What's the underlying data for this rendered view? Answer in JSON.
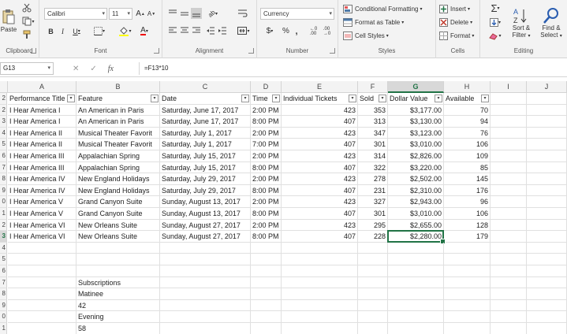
{
  "ribbon": {
    "clipboard": {
      "label": "Clipboard",
      "paste": "Paste"
    },
    "font": {
      "label": "Font",
      "name": "Calibri",
      "size": "11",
      "bold": "B",
      "italic": "I",
      "underline": "U",
      "grow": "A",
      "shrink": "A"
    },
    "alignment": {
      "label": "Alignment"
    },
    "number": {
      "label": "Number",
      "format": "Currency",
      "currency_symbol": "$",
      "percent": "%",
      "comma": ","
    },
    "styles": {
      "label": "Styles",
      "conditional": "Conditional Formatting",
      "format_table": "Format as Table",
      "cell_styles": "Cell Styles"
    },
    "cells": {
      "label": "Cells",
      "insert": "Insert",
      "delete": "Delete",
      "format": "Format"
    },
    "editing": {
      "label": "Editing",
      "sort1": "Sort &",
      "sort2": "Filter",
      "find1": "Find &",
      "find2": "Select"
    }
  },
  "formula_bar": {
    "name_box": "G13",
    "fx": "fx",
    "formula": "=F13*10"
  },
  "columns": [
    "A",
    "B",
    "C",
    "D",
    "E",
    "F",
    "G",
    "H",
    "I",
    "J"
  ],
  "selected_column": "G",
  "selected_row": "3",
  "header_row": {
    "row": "2",
    "cells": [
      "Performance Title",
      "Feature",
      "Date",
      "Time",
      "Individual Tickets",
      "Sold",
      "Dollar Value",
      "Available"
    ]
  },
  "rows": [
    {
      "num": "2",
      "cells": [
        "I Hear America I",
        "An American in Paris",
        "Saturday, June 17, 2017",
        "2:00 PM",
        "423",
        "353",
        "$3,177.00",
        "70"
      ]
    },
    {
      "num": "3",
      "cells": [
        "I Hear America I",
        "An American in Paris",
        "Saturday, June 17, 2017",
        "8:00 PM",
        "407",
        "313",
        "$3,130.00",
        "94"
      ]
    },
    {
      "num": "4",
      "cells": [
        "I Hear America II",
        "Musical Theater Favorit",
        "Saturday, July 1, 2017",
        "2:00 PM",
        "423",
        "347",
        "$3,123.00",
        "76"
      ]
    },
    {
      "num": "5",
      "cells": [
        "I Hear America II",
        "Musical Theater Favorit",
        "Saturday, July 1, 2017",
        "7:00 PM",
        "407",
        "301",
        "$3,010.00",
        "106"
      ]
    },
    {
      "num": "6",
      "cells": [
        "I Hear America III",
        "Appalachian Spring",
        "Saturday, July 15, 2017",
        "2:00 PM",
        "423",
        "314",
        "$2,826.00",
        "109"
      ]
    },
    {
      "num": "7",
      "cells": [
        "I Hear America III",
        "Appalachian Spring",
        "Saturday, July 15, 2017",
        "8:00 PM",
        "407",
        "322",
        "$3,220.00",
        "85"
      ]
    },
    {
      "num": "8",
      "cells": [
        "I Hear America IV",
        "New England Holidays",
        "Saturday, July 29, 2017",
        "2:00 PM",
        "423",
        "278",
        "$2,502.00",
        "145"
      ]
    },
    {
      "num": "9",
      "cells": [
        "I Hear America IV",
        "New England Holidays",
        "Saturday, July 29, 2017",
        "8:00 PM",
        "407",
        "231",
        "$2,310.00",
        "176"
      ]
    },
    {
      "num": "0",
      "cells": [
        "I Hear America V",
        "Grand Canyon Suite",
        "Sunday, August 13, 2017",
        "2:00 PM",
        "423",
        "327",
        "$2,943.00",
        "96"
      ]
    },
    {
      "num": "1",
      "cells": [
        "I Hear America V",
        "Grand Canyon Suite",
        "Sunday, August 13, 2017",
        "8:00 PM",
        "407",
        "301",
        "$3,010.00",
        "106"
      ]
    },
    {
      "num": "2",
      "cells": [
        "I Hear America VI",
        "New Orleans Suite",
        "Sunday, August 27, 2017",
        "2:00 PM",
        "423",
        "295",
        "$2,655.00",
        "128"
      ]
    },
    {
      "num": "3",
      "cells": [
        "I Hear America VI",
        "New Orleans Suite",
        "Sunday, August 27, 2017",
        "8:00 PM",
        "407",
        "228",
        "$2,280.00",
        "179"
      ]
    }
  ],
  "empty_rows": [
    "4",
    "5",
    "6"
  ],
  "extra_rows": [
    {
      "num": "7",
      "b": "Subscriptions"
    },
    {
      "num": "8",
      "b": "Matinee"
    },
    {
      "num": "9",
      "b": "42"
    },
    {
      "num": "0",
      "b": "Evening"
    },
    {
      "num": "1",
      "b": "58"
    }
  ]
}
